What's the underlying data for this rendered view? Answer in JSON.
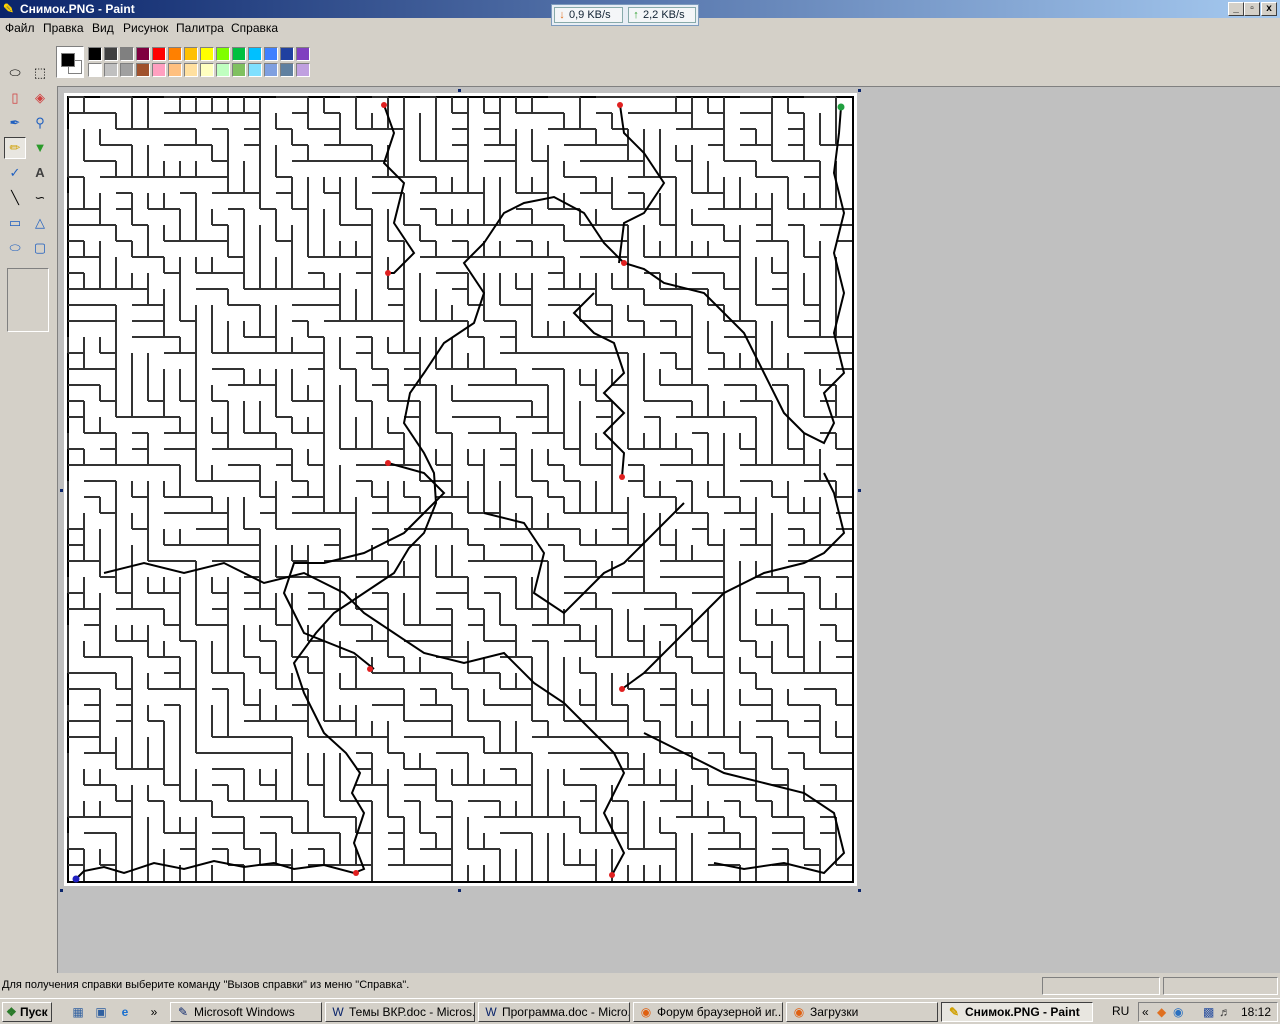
{
  "window": {
    "title": "Снимок.PNG - Paint",
    "controls": {
      "minimize": "_",
      "maximize": "▫",
      "close": "x"
    }
  },
  "speed_widget": {
    "download": "0,9 KB/s",
    "upload": "2,2 KB/s"
  },
  "menu": [
    "Файл",
    "Правка",
    "Вид",
    "Рисунок",
    "Палитра",
    "Справка"
  ],
  "tools": [
    "free-select",
    "rect-select",
    "eraser",
    "fill-bucket",
    "color-picker",
    "magnifier",
    "pencil",
    "brush",
    "airbrush",
    "text",
    "line",
    "curve",
    "rectangle",
    "polygon",
    "ellipse",
    "rounded-rectangle"
  ],
  "active_tool": "pencil",
  "palette": {
    "foreground": "#000000",
    "background": "#ffffff",
    "row1": [
      "#000000",
      "#404040",
      "#808080",
      "#800040",
      "#ff0000",
      "#ff8000",
      "#ffc000",
      "#ffff00",
      "#80ff00",
      "#00c040",
      "#00c0ff",
      "#4080ff",
      "#2040a0",
      "#8040c0"
    ],
    "row2": [
      "#ffffff",
      "#c0c0c0",
      "#a0a0a0",
      "#a0522d",
      "#ffa0c0",
      "#ffc080",
      "#ffe0a0",
      "#ffffc0",
      "#c0ffc0",
      "#80c060",
      "#80e0ff",
      "#80a0e0",
      "#6080a0",
      "#c0a0e0"
    ]
  },
  "canvas": {
    "image": "maze with solved path",
    "markers": {
      "start": "#2020c0",
      "end": "#20a040",
      "waypoint": "#e02020"
    }
  },
  "status": {
    "help_text": "Для получения справки выберите команду \"Вызов справки\" из меню \"Справка\"."
  },
  "taskbar": {
    "start_label": "Пуск",
    "tasks": [
      "Microsoft Windows",
      "Темы ВКР.doc - Micros...",
      "Программа.doc - Micro...",
      "Форум браузерной иг...",
      "Загрузки",
      "Снимок.PNG - Paint"
    ],
    "active_task": "Снимок.PNG - Paint",
    "chevron": "»",
    "tray": {
      "language": "RU",
      "expand": "«",
      "clock": "18:12"
    }
  }
}
